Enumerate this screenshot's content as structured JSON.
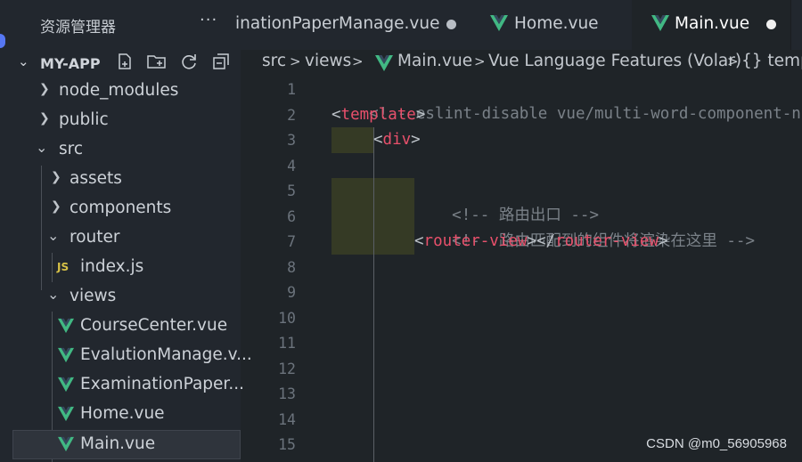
{
  "sidebar": {
    "title": "资源管理器",
    "more_label": "···",
    "explorer_label": "MY-APP",
    "header_icons": [
      "new-file-icon",
      "new-folder-icon",
      "refresh-icon",
      "collapse-all-icon"
    ],
    "items": [
      {
        "label": "node_modules",
        "type": "folder",
        "expanded": false
      },
      {
        "label": "public",
        "type": "folder",
        "expanded": false
      },
      {
        "label": "src",
        "type": "folder",
        "expanded": true
      },
      {
        "label": "assets",
        "type": "folder",
        "expanded": false
      },
      {
        "label": "components",
        "type": "folder",
        "expanded": false
      },
      {
        "label": "router",
        "type": "folder",
        "expanded": true
      },
      {
        "label": "index.js",
        "type": "js"
      },
      {
        "label": "views",
        "type": "folder",
        "expanded": true
      },
      {
        "label": "CourseCenter.vue",
        "type": "vue"
      },
      {
        "label": "EvalutionManage.v...",
        "type": "vue"
      },
      {
        "label": "ExaminationPaper...",
        "type": "vue"
      },
      {
        "label": "Home.vue",
        "type": "vue"
      },
      {
        "label": "Main.vue",
        "type": "vue",
        "selected": true
      }
    ]
  },
  "tabs": [
    {
      "label": "inationPaperManage.vue",
      "modified": true,
      "active": false
    },
    {
      "label": "Home.vue",
      "modified": false,
      "active": false
    },
    {
      "label": "Main.vue",
      "modified": true,
      "active": true
    }
  ],
  "breadcrumb": {
    "parts": [
      "src",
      ">",
      "views",
      ">",
      "Main.vue",
      ">",
      "Vue Language Features (Volar)",
      ">",
      "{} temp"
    ]
  },
  "editor": {
    "line_numbers": [
      "1",
      "2",
      "3",
      "4",
      "5",
      "6",
      "7",
      "8",
      "9",
      "10",
      "11",
      "12",
      "13",
      "14",
      "15"
    ],
    "lines": {
      "l1": "<!-- eslint-disable vue/multi-word-component-n",
      "l2_open": "<",
      "l2_tag": "template",
      "l2_close": ">",
      "l3_open": "<",
      "l3_tag": "div",
      "l3_close": ">",
      "l5": "<!-- 路由出口 -->",
      "l6": "<!-- 路由匹配到的组件将渲染在这里 -->",
      "l7_a": "<",
      "l7_tag1": "router-view",
      "l7_b": "></",
      "l7_tag2": "router-view",
      "l7_c": ">"
    }
  },
  "watermark": "CSDN @m0_56905968",
  "colors": {
    "vue_green": "#41b883",
    "tag_red": "#e8506b",
    "js_yellow": "#d8c247"
  }
}
